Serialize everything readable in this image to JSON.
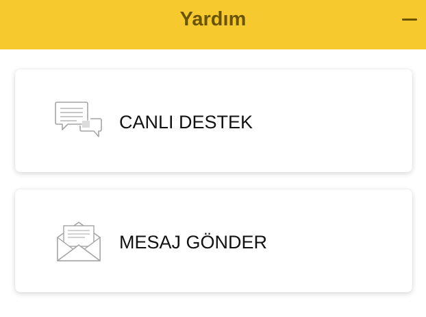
{
  "header": {
    "title": "Yardım",
    "minimize_icon": "minus-icon",
    "background_color": "#f6c92f",
    "title_color": "#6b5400"
  },
  "options": [
    {
      "label": "CANLI DESTEK",
      "icon": "chat-bubbles-icon"
    },
    {
      "label": "MESAJ GÖNDER",
      "icon": "envelope-icon"
    }
  ]
}
